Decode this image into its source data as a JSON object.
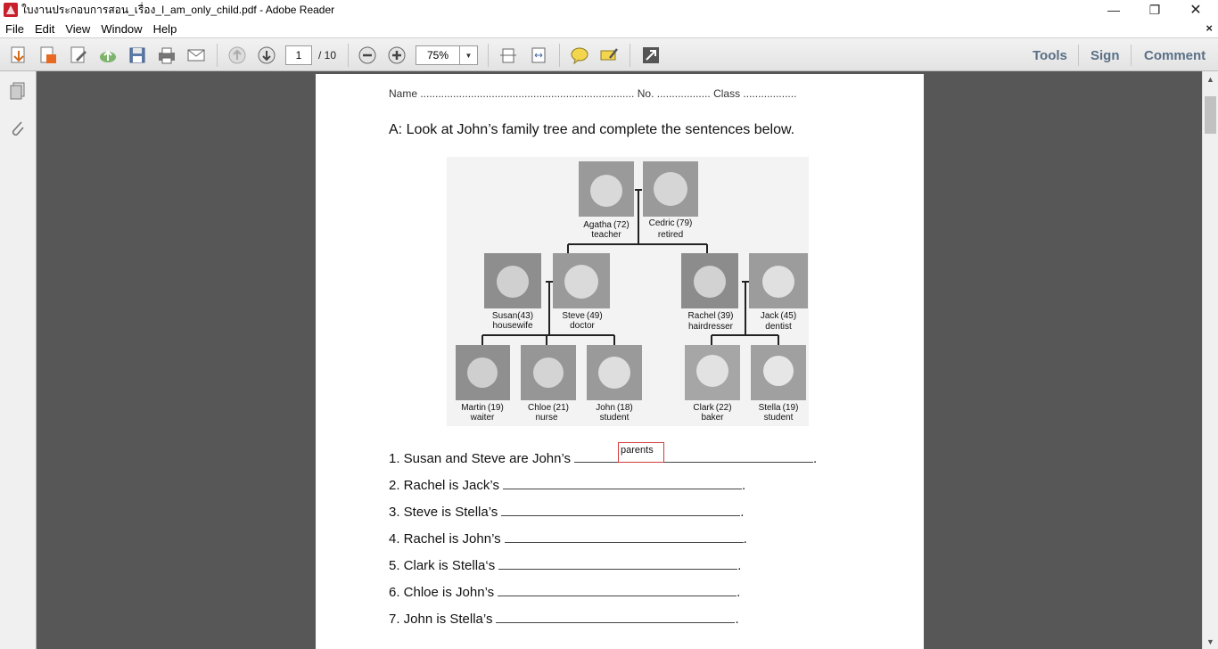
{
  "window": {
    "title": "ใบงานประกอบการสอน_เรื่อง_I_am_only_child.pdf - Adobe Reader",
    "minimize": "—",
    "maximize": "❐",
    "close": "✕"
  },
  "menu": {
    "items": [
      "File",
      "Edit",
      "View",
      "Window",
      "Help"
    ],
    "doc_close": "×"
  },
  "toolbar": {
    "page_current": "1",
    "page_total": "/ 10",
    "zoom": "75%",
    "links": [
      "Tools",
      "Sign",
      "Comment"
    ],
    "icons": [
      "create-pdf-icon",
      "convert-pdf-icon",
      "edit-pdf-icon",
      "upload-icon",
      "save-icon",
      "print-icon",
      "email-icon",
      "previous-page-icon",
      "next-page-icon",
      "zoom-out-icon",
      "zoom-in-icon",
      "fit-page-icon",
      "fit-width-icon",
      "comment-note-icon",
      "highlight-icon",
      "fullscreen-icon"
    ]
  },
  "worksheet": {
    "name_line": "Name ........................................................................ No. .................. Class ..................",
    "heading": "A:  Look at John’s family tree and complete the sentences below.",
    "family": [
      {
        "name": "Agatha",
        "age": "(72)",
        "job": "teacher"
      },
      {
        "name": "Cedric",
        "age": "(79)",
        "job": "retired"
      },
      {
        "name": "Susan",
        "age": "(43)",
        "job": "housewife"
      },
      {
        "name": "Steve",
        "age": "(49)",
        "job": "doctor"
      },
      {
        "name": "Rachel",
        "age": "(39)",
        "job": "hairdresser"
      },
      {
        "name": "Jack",
        "age": "(45)",
        "job": "dentist"
      },
      {
        "name": "Martin",
        "age": "(19)",
        "job": "waiter"
      },
      {
        "name": "Chloe",
        "age": "(21)",
        "job": "nurse"
      },
      {
        "name": "John",
        "age": "(18)",
        "job": "student"
      },
      {
        "name": "Clark",
        "age": "(22)",
        "job": "baker"
      },
      {
        "name": "Stella",
        "age": "(19)",
        "job": "student"
      }
    ],
    "sentences": [
      "1. Susan and Steve are John’s",
      "2. Rachel is Jack’s",
      "3. Steve is Stella’s",
      "4. Rachel is John’s",
      "5. Clark is Stella‘s",
      "6. Chloe is John’s",
      "7. John is Stella’s"
    ],
    "answer_text": "parents"
  },
  "colors": {
    "doc_bg": "#575757",
    "accent_link": "#5a6f86",
    "answer_border": "#d23a3a"
  }
}
